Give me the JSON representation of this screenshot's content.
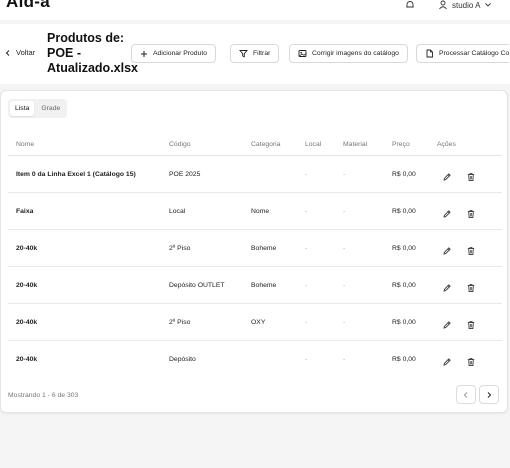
{
  "app": {
    "title": "Ald-a",
    "user": "studio A"
  },
  "header": {
    "back_label": "Voltar",
    "title": "Produtos de: POE - Atualizado.xlsx",
    "buttons": {
      "add": "Adicionar Produto",
      "filter": "Filtrar",
      "fix_images": "Corrigir imagens do catálogo",
      "process": "Processar Catálogo Co"
    }
  },
  "tabs": [
    {
      "label": "Lista",
      "active": true
    },
    {
      "label": "Grade",
      "active": false
    }
  ],
  "table": {
    "columns": [
      "Nome",
      "Código",
      "Categoria",
      "Local",
      "Material",
      "Preço",
      "Ações"
    ],
    "rows": [
      {
        "nome": "Item 0 da Linha Excel 1 (Catálogo 15)",
        "codigo": "POE 2025",
        "categoria": "",
        "local": "-",
        "material": "-",
        "preco": "R$ 0,00"
      },
      {
        "nome": "Faixa",
        "codigo": "Local",
        "categoria": "Nome",
        "local": "-",
        "material": "-",
        "preco": "R$ 0,00"
      },
      {
        "nome": "20-40k",
        "codigo": "2º Piso",
        "categoria": "Boheme",
        "local": "-",
        "material": "-",
        "preco": "R$ 0,00"
      },
      {
        "nome": "20-40k",
        "codigo": "Depósito OUTLET",
        "categoria": "Boheme",
        "local": "-",
        "material": "-",
        "preco": "R$ 0,00"
      },
      {
        "nome": "20-40k",
        "codigo": "2º Piso",
        "categoria": "OXY",
        "local": "-",
        "material": "-",
        "preco": "R$ 0,00"
      },
      {
        "nome": "20-40k",
        "codigo": "Depósito",
        "categoria": "",
        "local": "-",
        "material": "-",
        "preco": "R$ 0,00"
      }
    ]
  },
  "footer": {
    "showing": "Mostrando 1 - 6 de 303"
  },
  "icons": {
    "back": "chevron-left-icon",
    "add": "plus-icon",
    "filter": "filter-icon",
    "fix_images": "image-icon",
    "process": "file-icon",
    "edit": "pencil-icon",
    "delete": "trash-icon",
    "prev": "chevron-left-icon",
    "next": "chevron-right-icon",
    "bell": "bell-icon",
    "user": "user-icon"
  }
}
